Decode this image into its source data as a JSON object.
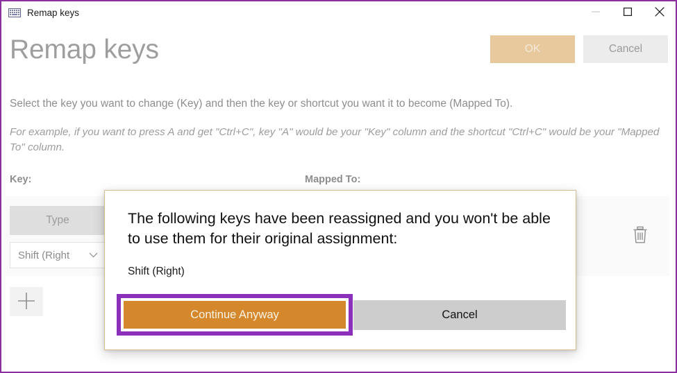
{
  "window": {
    "title": "Remap keys",
    "app_icon": "keyboard-icon",
    "border_color": "#8b2f9e",
    "controls": {
      "minimize": "minimize-icon",
      "maximize": "maximize-icon",
      "close": "close-icon"
    }
  },
  "header": {
    "page_title": "Remap keys",
    "ok_label": "OK",
    "cancel_label": "Cancel",
    "ok_color": "#e8c89d",
    "cancel_color": "#ececec"
  },
  "descriptions": {
    "primary": "Select the key you want to change (Key) and then the key or shortcut you want it to become (Mapped To).",
    "secondary": "For example, if you want to press A and get \"Ctrl+C\", key \"A\" would be your \"Key\" column and the shortcut \"Ctrl+C\" would be your \"Mapped To\" column."
  },
  "columns": {
    "key_header": "Key:",
    "mapped_header": "Mapped To:"
  },
  "remap_row": {
    "type_button_label": "Type",
    "key_value": "Shift (Right",
    "chevron": "chevron-down-icon",
    "delete_icon": "trash-icon"
  },
  "add_row": {
    "icon": "plus-icon"
  },
  "dialog": {
    "message": "The following keys have been reassigned and you won't be able to use them for their original assignment:",
    "key_list": "Shift (Right)",
    "continue_label": "Continue Anyway",
    "cancel_label": "Cancel",
    "continue_color": "#d4882b",
    "focus_ring_color": "#8b30ba",
    "cancel_color": "#cdcdcd",
    "border_color": "#d8bf96"
  }
}
